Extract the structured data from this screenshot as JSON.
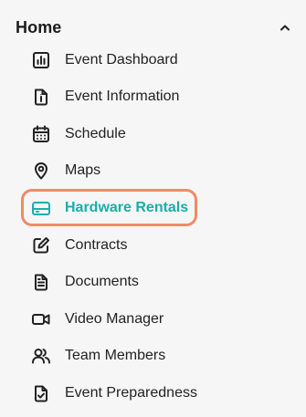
{
  "nav": {
    "section": {
      "title": "Home",
      "expanded": true,
      "chevron_icon": "chevron-up-icon"
    },
    "active_color": "#1aaeaa",
    "highlight_color": "#ef8b67",
    "items": [
      {
        "label": "Event Dashboard",
        "icon": "bar-chart-icon",
        "active": false
      },
      {
        "label": "Event Information",
        "icon": "document-info-icon",
        "active": false
      },
      {
        "label": "Schedule",
        "icon": "calendar-icon",
        "active": false
      },
      {
        "label": "Maps",
        "icon": "map-pin-icon",
        "active": false
      },
      {
        "label": "Hardware Rentals",
        "icon": "hard-drive-icon",
        "active": true
      },
      {
        "label": "Contracts",
        "icon": "edit-square-icon",
        "active": false
      },
      {
        "label": "Documents",
        "icon": "file-text-icon",
        "active": false
      },
      {
        "label": "Video Manager",
        "icon": "video-camera-icon",
        "active": false
      },
      {
        "label": "Team Members",
        "icon": "users-icon",
        "active": false
      },
      {
        "label": "Event Preparedness",
        "icon": "file-check-icon",
        "active": false
      }
    ]
  }
}
